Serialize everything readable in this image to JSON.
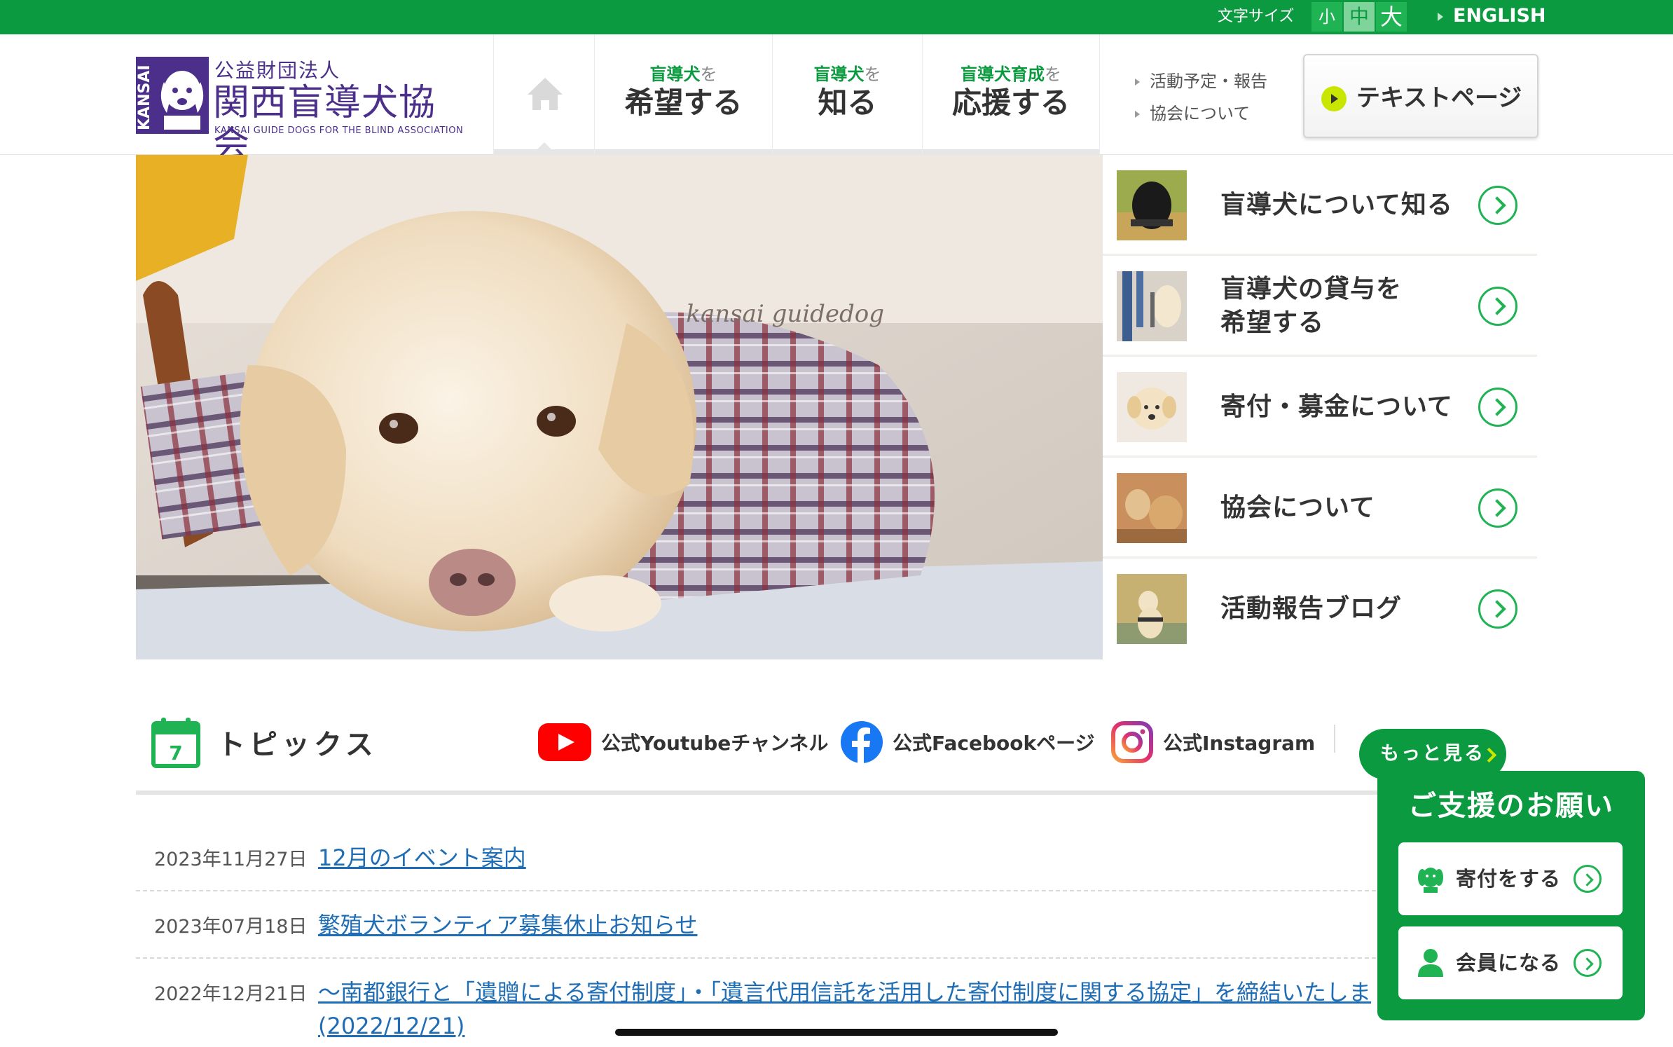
{
  "topbar": {
    "font_size_label": "文字サイズ",
    "font_sizes": [
      "小",
      "中",
      "大"
    ],
    "english": "ENGLISH"
  },
  "logo": {
    "side_text": "KANSAI",
    "corp": "公益財団法人",
    "name": "関西盲導犬協会",
    "english": "KANSAI GUIDE DOGS FOR THE BLIND ASSOCIATION"
  },
  "nav": {
    "home_icon": "home-icon",
    "items": [
      {
        "pre": "盲導犬",
        "wo": "を",
        "main": "希望する"
      },
      {
        "pre": "盲導犬",
        "wo": "を",
        "main": "知る"
      },
      {
        "pre": "盲導犬育成",
        "wo": "を",
        "main": "応援する"
      }
    ],
    "sublinks": [
      "活動予定・報告",
      "協会について"
    ],
    "text_page": "テキストページ"
  },
  "hero": {
    "watermark": "kansai guidedog"
  },
  "menu": [
    {
      "label": "盲導犬について知る",
      "icon": "chevron-right-icon"
    },
    {
      "label": "盲導犬の貸与を\n希望する",
      "icon": "chevron-right-icon"
    },
    {
      "label": "寄付・募金について",
      "icon": "chevron-right-icon"
    },
    {
      "label": "協会について",
      "icon": "chevron-right-icon"
    },
    {
      "label": "活動報告ブログ",
      "icon": "chevron-right-icon"
    }
  ],
  "topics": {
    "calendar_day": "7",
    "title": "トピックス",
    "social": [
      {
        "icon": "youtube-icon",
        "label": "公式Youtubeチャンネル"
      },
      {
        "icon": "facebook-icon",
        "label": "公式Facebookページ"
      },
      {
        "icon": "instagram-icon",
        "label": "公式Instagram"
      }
    ],
    "more": "もっと見る",
    "news": [
      {
        "date": "2023年11月27日",
        "title": "12月のイベント案内"
      },
      {
        "date": "2023年07月18日",
        "title": "繁殖犬ボランティア募集休止お知らせ"
      },
      {
        "date": "2022年12月21日",
        "title": "〜南都銀行と「遺贈による寄付制度」・「遺言代用信託を活用した寄付制度に関する協定」を締結いたしま",
        "title2": "(2022/12/21)"
      }
    ]
  },
  "support": {
    "title": "ご支援のお願い",
    "buttons": [
      {
        "icon": "dog-icon",
        "label": "寄付をする"
      },
      {
        "icon": "person-icon",
        "label": "会員になる"
      }
    ]
  },
  "colors": {
    "brand_green": "#0c9a40",
    "accent_green": "#1fb354",
    "logo_purple": "#4b2f8a",
    "link_blue": "#1e6db5",
    "lime": "#c9e600"
  }
}
